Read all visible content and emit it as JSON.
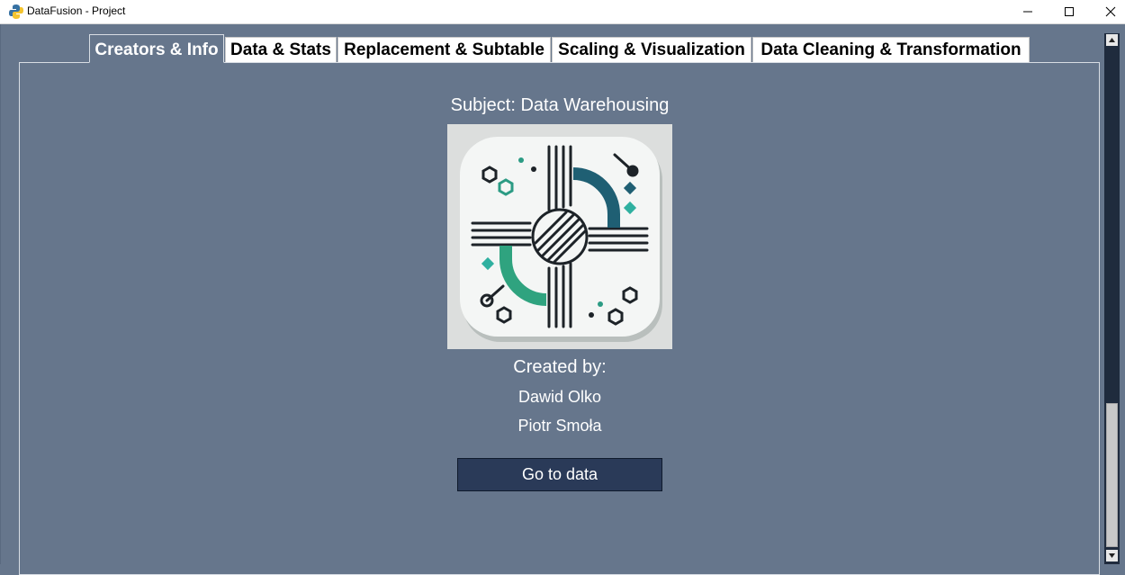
{
  "window": {
    "title": "DataFusion - Project",
    "icon": "python-icon",
    "controls": [
      "minimize-icon",
      "maximize-icon",
      "close-icon"
    ]
  },
  "tabs": [
    {
      "label": "Creators & Info",
      "active": true
    },
    {
      "label": "Data & Stats",
      "active": false
    },
    {
      "label": "Replacement & Subtable",
      "active": false
    },
    {
      "label": "Scaling & Visualization",
      "active": false
    },
    {
      "label": "Data Cleaning & Transformation",
      "active": false
    }
  ],
  "main": {
    "subject": "Subject: Data Warehousing",
    "logo": "circuit-logo-image",
    "created_by": "Created by:",
    "authors": [
      "Dawid Olko",
      "Piotr Smoła"
    ],
    "go_button": "Go to data"
  },
  "colors": {
    "background": "#66768c",
    "button": "#2a3a58",
    "tab_inactive": "#ffffff",
    "scrollbar": "#1f2b3d"
  }
}
